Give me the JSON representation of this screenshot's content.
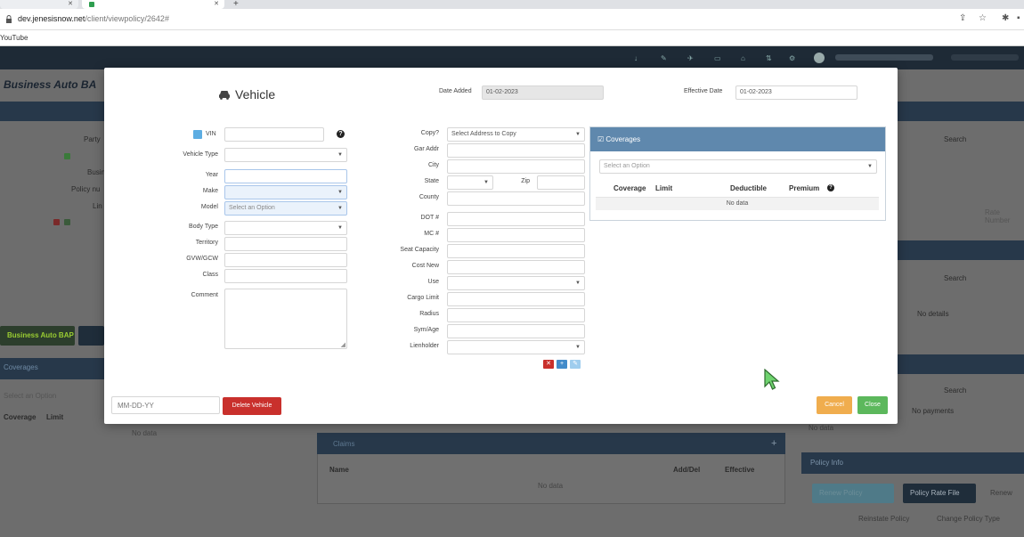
{
  "browser": {
    "url_host": "dev.jenesisnow.net",
    "url_path": "/client/viewpolicy/2642#",
    "bookmark": "YouTube"
  },
  "background": {
    "app_title": "Business Auto BA",
    "left_labels": [
      "Party",
      "Busin",
      "Policy nu",
      "Lin"
    ],
    "tab_active": "Business Auto BAP",
    "coverages_header": "Coverages",
    "coverages_select": "Select an Option",
    "coverage_col": "Coverage",
    "limit_col": "Limit",
    "no_data": "No data",
    "bottom_table": {
      "header": "Claims",
      "columns": [
        "Name",
        "Add/Del",
        "Effective"
      ],
      "no_data": "No data"
    },
    "right": {
      "search1": "Search",
      "search2": "Search",
      "search3": "Search",
      "no_details": "No details",
      "no_payments": "No payments",
      "policy_info": "Policy Info",
      "btn_teal": "Renew Policy",
      "btn_dark": "Policy Rate File",
      "btn_renew": "Renew",
      "reinstate": "Reinstate Policy",
      "change_type": "Change Policy Type",
      "rate_number": "Rate Number",
      "no_data": "No data"
    }
  },
  "modal": {
    "title": "Vehicle",
    "date_added_label": "Date Added",
    "date_added_value": "01-02-2023",
    "effective_date_label": "Effective Date",
    "effective_date_value": "01-02-2023",
    "left_fields": {
      "vin": "VIN",
      "vehicle_type": "Vehicle Type",
      "year": "Year",
      "make": "Make",
      "model": "Model",
      "model_placeholder": "Select an Option",
      "body_type": "Body Type",
      "territory": "Territory",
      "gvw_gcw": "GVW/GCW",
      "class": "Class",
      "comment": "Comment"
    },
    "mid_fields": {
      "copy": "Copy?",
      "copy_value": "Select Address to Copy",
      "gar_addr": "Gar Addr",
      "city": "City",
      "state": "State",
      "zip": "Zip",
      "county": "County",
      "dot": "DOT #",
      "mc": "MC #",
      "seat_capacity": "Seat Capacity",
      "cost_new": "Cost New",
      "use": "Use",
      "cargo_limit": "Cargo Limit",
      "radius": "Radius",
      "sym_age": "Sym/Age",
      "lienholder": "Lienholder"
    },
    "coverages": {
      "header": "Coverages",
      "select_placeholder": "Select an Option",
      "col_coverage": "Coverage",
      "col_limit": "Limit",
      "col_deductible": "Deductible",
      "col_premium": "Premium",
      "no_data": "No data"
    },
    "footer": {
      "date_placeholder": "MM-DD-YY",
      "delete_label": "Delete Vehicle",
      "cancel_label": "Cancel",
      "close_label": "Close"
    }
  },
  "colors": {
    "coverage_header": "#5f88ad",
    "delete": "#c9302c",
    "cancel": "#f0ad4e",
    "close": "#5cb85c"
  }
}
